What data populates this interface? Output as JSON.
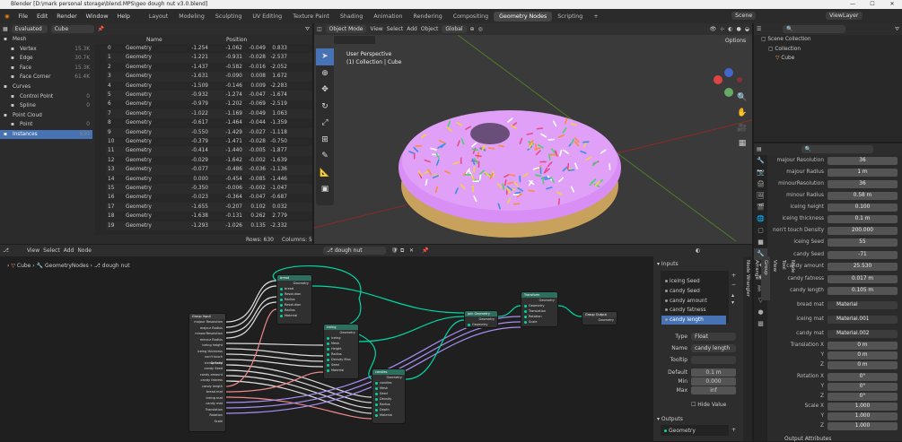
{
  "title": "Blender [D:\\mark personal storage\\blend.MPS\\geo dough nut v3.0.blend]",
  "menu": [
    "File",
    "Edit",
    "Render",
    "Window",
    "Help"
  ],
  "workspaces": [
    "Layout",
    "Modeling",
    "Sculpting",
    "UV Editing",
    "Texture Paint",
    "Shading",
    "Animation",
    "Rendering",
    "Compositing",
    "Geometry Nodes",
    "Scripting"
  ],
  "active_workspace": "Geometry Nodes",
  "scene_label": "Scene",
  "view_layer_label": "ViewLayer",
  "spreadsheet": {
    "mode": "Evaluated",
    "object": "Cube",
    "domains": [
      {
        "label": "Mesh",
        "count": "",
        "indent": 0
      },
      {
        "label": "Vertex",
        "count": "15.3K",
        "indent": 1
      },
      {
        "label": "Edge",
        "count": "30.7K",
        "indent": 1
      },
      {
        "label": "Face",
        "count": "15.3K",
        "indent": 1
      },
      {
        "label": "Face Corner",
        "count": "61.4K",
        "indent": 1
      },
      {
        "label": "Curves",
        "count": "",
        "indent": 0
      },
      {
        "label": "Control Point",
        "count": "0",
        "indent": 1
      },
      {
        "label": "Spline",
        "count": "0",
        "indent": 1
      },
      {
        "label": "Point Cloud",
        "count": "",
        "indent": 0
      },
      {
        "label": "Point",
        "count": "0",
        "indent": 1
      },
      {
        "label": "Instances",
        "count": "630",
        "indent": 0
      }
    ],
    "columns": [
      "Name",
      "Position"
    ],
    "rows": [
      [
        "0",
        "Geometry",
        "-1.254",
        "-1.062",
        "-0.049",
        "0.833"
      ],
      [
        "1",
        "Geometry",
        "-1.221",
        "-0.931",
        "-0.028",
        "-2.537"
      ],
      [
        "2",
        "Geometry",
        "-1.437",
        "-0.582",
        "-0.016",
        "-2.052"
      ],
      [
        "3",
        "Geometry",
        "-1.631",
        "-0.090",
        "0.008",
        "1.672"
      ],
      [
        "4",
        "Geometry",
        "-1.509",
        "-0.146",
        "0.009",
        "-2.283"
      ],
      [
        "5",
        "Geometry",
        "-0.932",
        "-1.274",
        "-0.047",
        "-1.674"
      ],
      [
        "6",
        "Geometry",
        "-0.979",
        "-1.202",
        "-0.069",
        "-2.519"
      ],
      [
        "7",
        "Geometry",
        "-1.022",
        "-1.169",
        "-0.049",
        "1.063"
      ],
      [
        "8",
        "Geometry",
        "-0.617",
        "-1.464",
        "-0.044",
        "-1.359"
      ],
      [
        "9",
        "Geometry",
        "-0.550",
        "-1.429",
        "-0.027",
        "-1.118"
      ],
      [
        "10",
        "Geometry",
        "-0.379",
        "-1.471",
        "-0.028",
        "-0.750"
      ],
      [
        "11",
        "Geometry",
        "-0.414",
        "-1.440",
        "-0.005",
        "-1.877"
      ],
      [
        "12",
        "Geometry",
        "-0.029",
        "-1.642",
        "-0.002",
        "-1.639"
      ],
      [
        "13",
        "Geometry",
        "-0.077",
        "-0.486",
        "-0.036",
        "-1.136"
      ],
      [
        "14",
        "Geometry",
        "0.000",
        "-0.454",
        "-0.085",
        "-1.446"
      ],
      [
        "15",
        "Geometry",
        "-0.350",
        "-0.006",
        "-0.002",
        "-1.047"
      ],
      [
        "16",
        "Geometry",
        "-0.023",
        "-0.364",
        "-0.047",
        "-0.687"
      ],
      [
        "17",
        "Geometry",
        "-1.655",
        "-0.207",
        "0.102",
        "0.032"
      ],
      [
        "18",
        "Geometry",
        "-1.638",
        "-0.131",
        "0.262",
        "2.779"
      ],
      [
        "19",
        "Geometry",
        "-1.293",
        "-1.026",
        "0.135",
        "-2.332"
      ]
    ],
    "footer_rows": "Rows: 630",
    "footer_cols": "Columns: 5"
  },
  "viewport": {
    "mode": "Object Mode",
    "menus": [
      "View",
      "Select",
      "Add",
      "Object"
    ],
    "transform": "Global",
    "info1": "User Perspective",
    "info2": "(1) Collection | Cube",
    "options": "Options"
  },
  "outliner": {
    "items": [
      {
        "label": "Scene Collection",
        "indent": 0
      },
      {
        "label": "Collection",
        "indent": 1
      },
      {
        "label": "Cube",
        "indent": 2
      }
    ]
  },
  "modifier_props": [
    {
      "label": "majour Resolution",
      "value": "36"
    },
    {
      "label": "majour Radius",
      "value": "1 m"
    },
    {
      "label": "minourResolution",
      "value": "36"
    },
    {
      "label": "minour Radius",
      "value": "0.58 m"
    },
    {
      "label": "iceing height",
      "value": "0.100"
    },
    {
      "label": "iceing thickness",
      "value": "0.1 m"
    },
    {
      "label": "non't touch Density",
      "value": "200.000"
    },
    {
      "label": "iceing Seed",
      "value": "55"
    },
    {
      "label": "candy Seed",
      "value": "-71"
    },
    {
      "label": "candy amount",
      "value": "25.530"
    },
    {
      "label": "candy fatness",
      "value": "0.017 m"
    },
    {
      "label": "candy length",
      "value": "0.105 m"
    },
    {
      "label": "bread mat",
      "value": "Material"
    },
    {
      "label": "iceing mat",
      "value": "Material.001"
    },
    {
      "label": "candy mat",
      "value": "Material.002"
    },
    {
      "label": "Translation X",
      "value": "0 m"
    },
    {
      "label": "Y",
      "value": "0 m"
    },
    {
      "label": "Z",
      "value": "0 m"
    },
    {
      "label": "Rotation X",
      "value": "0°"
    },
    {
      "label": "Y",
      "value": "0°"
    },
    {
      "label": "Z",
      "value": "0°"
    },
    {
      "label": "Scale X",
      "value": "1.000"
    },
    {
      "label": "Y",
      "value": "1.000"
    },
    {
      "label": "Z",
      "value": "1.000"
    }
  ],
  "props_footer": "Output Attributes",
  "node_editor": {
    "menus": [
      "View",
      "Select",
      "Add",
      "Node"
    ],
    "tree_name": "dough nut",
    "breadcrumb": [
      "Cube",
      "GeometryNodes",
      "dough nut"
    ]
  },
  "nodes": {
    "group_input": {
      "title": "Group Input",
      "outputs": [
        "majour Resolution",
        "majour Radius",
        "minourResolution",
        "minour Radius",
        "iceing height",
        "iceing thickness",
        "non't touch Density",
        "iceing Seed",
        "candy Seed",
        "candy amount",
        "candy fatness",
        "candy length",
        "bread mat",
        "iceing mat",
        "candy mat",
        "Translation",
        "Rotation",
        "Scale"
      ]
    },
    "bread": {
      "title": "bread",
      "rows": [
        "Geometry",
        "bread",
        "Resolution",
        "Radius",
        "Resolution",
        "Radius",
        "Material"
      ]
    },
    "iceing": {
      "title": "iceing",
      "rows": [
        "Geometry",
        "iceing",
        "Mesh",
        "Height",
        "Radius",
        "Density Max",
        "Seed",
        "Material"
      ]
    },
    "candies": {
      "title": "candies",
      "rows": [
        "Geometry",
        "candies",
        "Mesh",
        "Seed",
        "Density",
        "Radius",
        "Depth",
        "Material"
      ]
    },
    "join": {
      "title": "Join Geometry",
      "rows": [
        "Geometry",
        "Geometry"
      ]
    },
    "transform": {
      "title": "Transform",
      "rows": [
        "Geometry",
        "Geometry",
        "Translation",
        "Rotation",
        "Scale"
      ]
    },
    "group_output": {
      "title": "Group Output",
      "rows": [
        "Geometry"
      ]
    }
  },
  "group_sidebar": {
    "inputs_header": "Inputs",
    "inputs": [
      "iceing Seed",
      "candy Seed",
      "candy amount",
      "candy fatness",
      "candy length"
    ],
    "type_label": "Type",
    "type_value": "Float",
    "name_label": "Name",
    "name_value": "candy length",
    "tooltip_label": "Tooltip",
    "default_label": "Default",
    "default_value": "0.1 m",
    "min_label": "Min",
    "min_value": "0.000",
    "max_label": "Max",
    "max_value": "inf",
    "hide_value": "Hide Value",
    "outputs_header": "Outputs",
    "outputs": [
      "Geometry"
    ],
    "tabs": [
      "Node",
      "Tool",
      "View",
      "Group",
      "Arrange",
      "Node Wrangler"
    ]
  },
  "colors": {
    "accent": "#4772b3",
    "node_geometry": "#00d6a3",
    "donut": "#d98ef5",
    "bread": "#c8a15c"
  }
}
